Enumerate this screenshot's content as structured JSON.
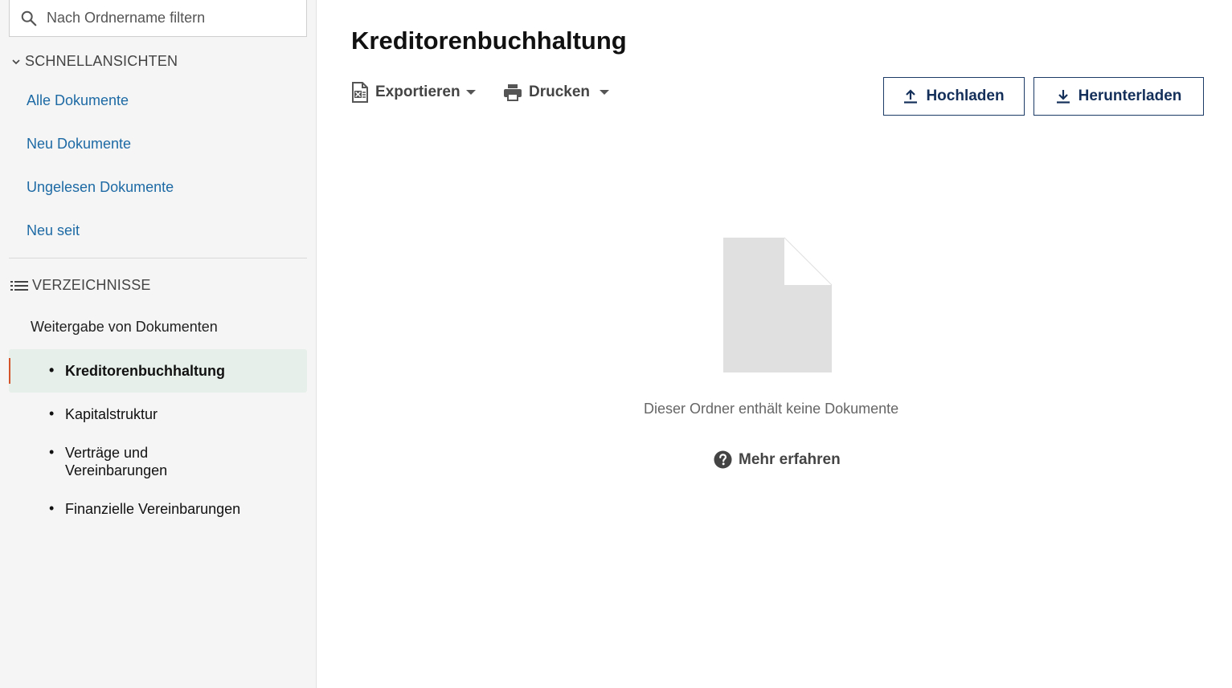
{
  "sidebar": {
    "filter": {
      "placeholder": "Nach Ordnername filtern"
    },
    "quick_views": {
      "title": "SCHNELLANSICHTEN",
      "items": [
        {
          "label": "Alle Dokumente"
        },
        {
          "label": "Neu Dokumente"
        },
        {
          "label": "Ungelesen Dokumente"
        },
        {
          "label": "Neu seit"
        }
      ]
    },
    "directories": {
      "title": "VERZEICHNISSE",
      "root": "Weitergabe von Dokumenten",
      "items": [
        {
          "label": "Kreditorenbuchhaltung",
          "active": true
        },
        {
          "label": "Kapitalstruktur"
        },
        {
          "label": "Verträge und\nVereinbarungen"
        },
        {
          "label": "Finanzielle Vereinbarungen"
        }
      ],
      "bullet": "•"
    }
  },
  "main": {
    "title": "Kreditorenbuchhaltung",
    "toolbar": {
      "export_label": "Exportieren",
      "print_label": "Drucken",
      "upload_label": "Hochladen",
      "download_label": "Herunterladen"
    },
    "empty_state": {
      "message": "Dieser Ordner enthält keine Dokumente",
      "learn_more": "Mehr erfahren"
    }
  },
  "colors": {
    "link": "#1d6aa5",
    "accent": "#d4552b",
    "button_border": "#1b3a66",
    "active_bg": "#e7efea"
  }
}
